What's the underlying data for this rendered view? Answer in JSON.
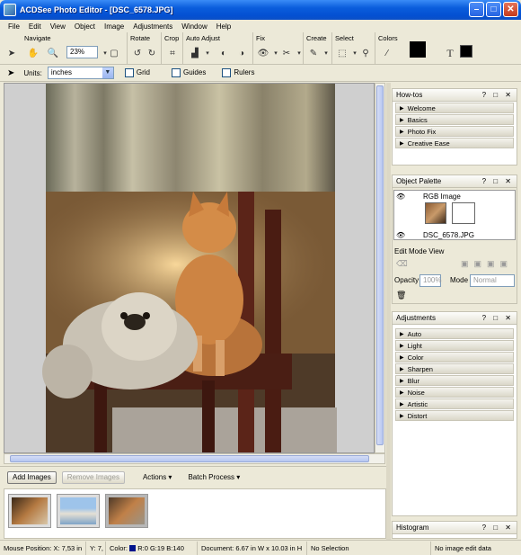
{
  "window": {
    "title": "ACDSee Photo Editor  - [DSC_6578.JPG]",
    "minimize": "–",
    "maximize": "□",
    "close": "✕"
  },
  "menu": [
    "File",
    "Edit",
    "View",
    "Object",
    "Image",
    "Adjustments",
    "Window",
    "Help"
  ],
  "toolbar": {
    "groups": [
      "Navigate",
      "Rotate",
      "Crop",
      "Auto Adjust",
      "Fix",
      "Create",
      "Select",
      "Colors"
    ],
    "zoom": "23%",
    "text_tool": "T"
  },
  "options": {
    "units_label": "Units:",
    "units_value": "inches",
    "grid": "Grid",
    "guides": "Guides",
    "rulers": "Rulers"
  },
  "panels": {
    "howtos": {
      "title": "How-tos",
      "items": [
        "Welcome",
        "Basics",
        "Photo Fix",
        "Creative Ease"
      ]
    },
    "object_palette": {
      "title": "Object Palette",
      "layer1": "RGB Image",
      "layer2": "DSC_6578.JPG",
      "edit_mode": "Edit Mode View",
      "opacity_label": "Opacity",
      "opacity_value": "100%",
      "mode_label": "Mode",
      "mode_value": "Normal"
    },
    "adjustments": {
      "title": "Adjustments",
      "items": [
        "Auto",
        "Light",
        "Color",
        "Sharpen",
        "Blur",
        "Noise",
        "Artistic",
        "Distort"
      ]
    },
    "histogram": {
      "title": "Histogram"
    },
    "controls": "? □ ✕"
  },
  "bottom": {
    "add_images": "Add Images",
    "remove_images": "Remove Images",
    "actions": "Actions",
    "batch_process": "Batch Process"
  },
  "status": {
    "mouse": "Mouse Position:  X: 7,53 in",
    "y": "Y: 7,",
    "color": "Color:",
    "rgb": "R:0  G:19  B:140",
    "document": "Document: 6.67 in W x 10.03 in H",
    "selection": "No Selection",
    "edit": "No image edit data"
  },
  "colors": {
    "title_blue": "#0a5ddc",
    "panel_bg": "#ece9d8",
    "status_color_swatch": "#00138c"
  }
}
